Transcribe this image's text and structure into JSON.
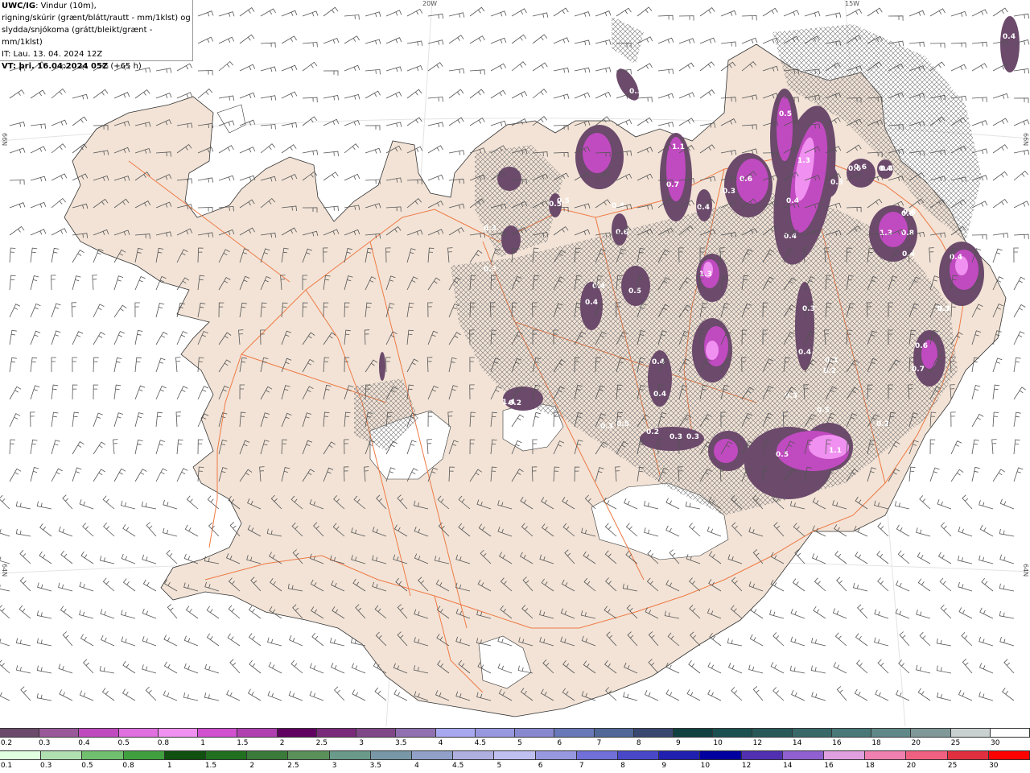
{
  "header": {
    "model": "UWC/IG",
    "desc1": ": Vindur (10m),",
    "desc2": "rigning/skúrir (grænt/blátt/rautt - mm/1klst) og",
    "desc3": "slydda/snjókoma (grátt/bleikt/grænt - mm/1klst)",
    "it": "IT: Lau. 13. 04. 2024 12Z",
    "vt_bold": "VT: þri. 16.04.2024 05Z",
    "vt_suffix": " (+65 h)"
  },
  "graticule": {
    "lon_top": [
      "20W",
      "15W"
    ],
    "lat_left": [
      "66N",
      "64N"
    ],
    "lat_right": [
      "66N",
      "64N"
    ]
  },
  "map_values": [
    "0.4",
    "0.3",
    "0.5",
    "0.8",
    "0.6",
    "0.5",
    "0.4",
    "1.3",
    "0.3",
    "1.1",
    "0.3",
    "0.3",
    "0.8",
    "0.4",
    "0.6",
    "0.7",
    "0.6",
    "0.4",
    "0.3",
    "0.8",
    "0.4",
    "0.4",
    "1.3",
    "0.5",
    "0.3",
    "0.4",
    "0.4",
    "1.3",
    "0.6",
    "0.3",
    "0.4",
    "0.3",
    "0.5",
    "1.1",
    "0.5",
    "0.2",
    "0.3",
    "0.3",
    "0.4",
    "0.6",
    "0.4",
    "0.7",
    "0.4",
    "0.5",
    "0.4",
    "0.3",
    "0.2",
    "0.3",
    "0.5",
    "0.2",
    "0.2",
    "0.4",
    "1.4",
    "0.3"
  ],
  "legend_snow": {
    "labels": [
      "0.2",
      "0.3",
      "0.4",
      "0.5",
      "0.8",
      "1",
      "1.5",
      "2",
      "2.5",
      "3",
      "3.5",
      "4",
      "4.5",
      "5",
      "6",
      "7",
      "8",
      "9",
      "10",
      "12",
      "14",
      "16",
      "18",
      "20",
      "25",
      "30"
    ],
    "colors": [
      "#6b4a6b",
      "#9a5a9a",
      "#c04ac0",
      "#e070e0",
      "#f090f0",
      "#d050d0",
      "#b040b0",
      "#600060",
      "#7a2a7a",
      "#804888",
      "#9070b0",
      "#a8a8f0",
      "#9898e0",
      "#8888d0",
      "#6878b8",
      "#506898",
      "#384870",
      "#104040",
      "#1a5050",
      "#285858",
      "#386868",
      "#487878",
      "#608888",
      "#809898",
      "#c8d0d0",
      "#ffffff"
    ]
  },
  "legend_rain": {
    "labels": [
      "0.1",
      "0.3",
      "0.5",
      "0.8",
      "1",
      "1.5",
      "2",
      "2.5",
      "3",
      "3.5",
      "4",
      "4.5",
      "5",
      "6",
      "7",
      "8",
      "9",
      "10",
      "12",
      "14",
      "16",
      "18",
      "20",
      "25",
      "30"
    ],
    "colors": [
      "#e0ffe0",
      "#b0e0b0",
      "#70c070",
      "#40a040",
      "#105010",
      "#207020",
      "#3a7a3a",
      "#5a905a",
      "#6a9a8a",
      "#7898a8",
      "#90a0c8",
      "#b0b0e0",
      "#c0c0f0",
      "#9898e0",
      "#7070d8",
      "#4848c8",
      "#2020b0",
      "#0000a0",
      "#5030b0",
      "#9060d0",
      "#e0a0e0",
      "#f080b0",
      "#f06080",
      "#e03040",
      "#ff0000"
    ]
  }
}
